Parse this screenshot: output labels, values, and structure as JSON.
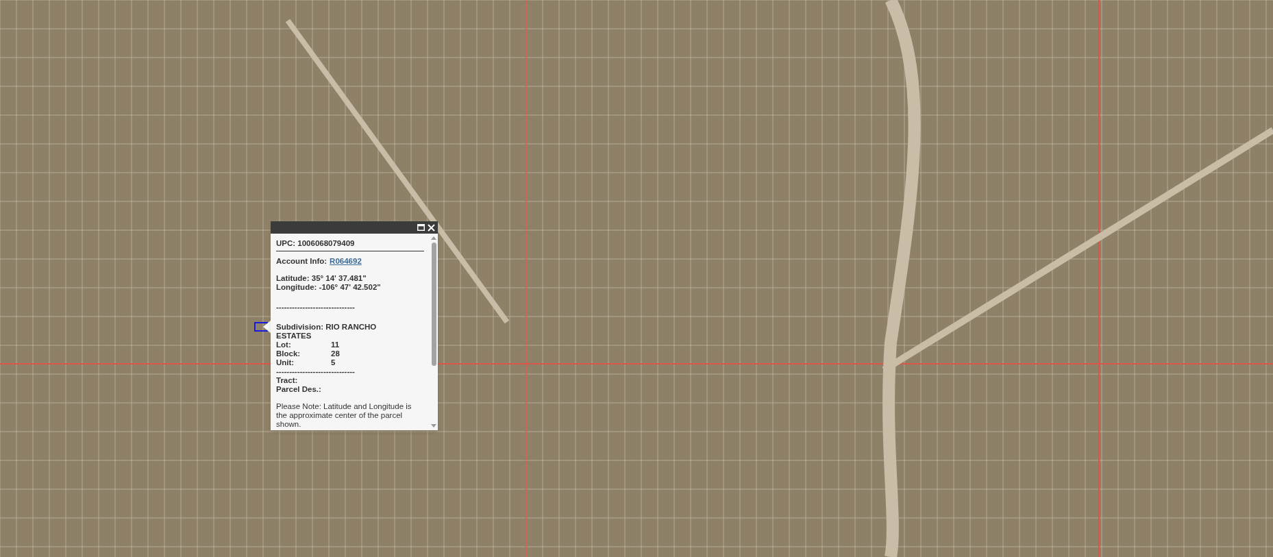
{
  "popup": {
    "upc": "UPC: 1006068079409",
    "account_label": "Account Info:",
    "account_link": "R064692",
    "latitude": "Latitude: 35° 14' 37.481\"",
    "longitude": "Longitude: -106° 47' 42.502\"",
    "separator": "------------------------------",
    "subdivision": "Subdivision: RIO RANCHO ESTATES",
    "fields": [
      {
        "label": "Lot:",
        "value": "11"
      },
      {
        "label": "Block:",
        "value": "28"
      },
      {
        "label": "Unit:",
        "value": "5"
      }
    ],
    "separator_2": "------------------------------",
    "tract": "Tract:",
    "parcel_des": "Parcel Des.:",
    "note": "Please Note: Latitude and Longitude is the approximate center of the parcel shown."
  }
}
